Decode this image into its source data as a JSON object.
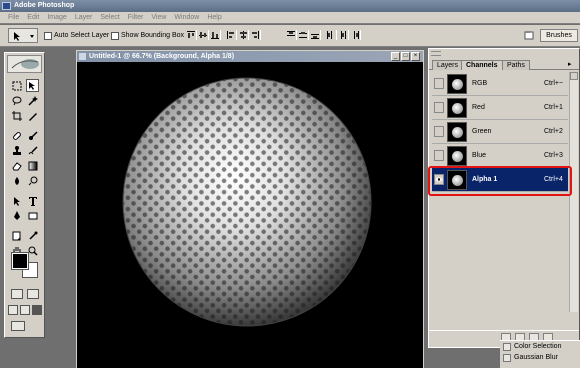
{
  "app": {
    "title": "Adobe Photoshop"
  },
  "menu": [
    "File",
    "Edit",
    "Image",
    "Layer",
    "Select",
    "Filter",
    "View",
    "Window",
    "Help"
  ],
  "options": {
    "auto_select_layer": "Auto Select Layer",
    "show_bounding_box": "Show Bounding Box",
    "brushes_tab": "Brushes"
  },
  "document": {
    "title": "Untitled-1 @ 66.7% (Background, Alpha 1/8)"
  },
  "palette": {
    "tabs": [
      "Layers",
      "Channels",
      "Paths"
    ],
    "active_tab": "Channels",
    "channels": [
      {
        "name": "RGB",
        "shortcut": "Ctrl+~",
        "visible": false,
        "selected": false
      },
      {
        "name": "Red",
        "shortcut": "Ctrl+1",
        "visible": false,
        "selected": false
      },
      {
        "name": "Green",
        "shortcut": "Ctrl+2",
        "visible": false,
        "selected": false
      },
      {
        "name": "Blue",
        "shortcut": "Ctrl+3",
        "visible": false,
        "selected": false
      },
      {
        "name": "Alpha 1",
        "shortcut": "Ctrl+4",
        "visible": true,
        "selected": true
      }
    ]
  },
  "history": {
    "items": [
      "Color Selection",
      "Gaussian Blur"
    ]
  },
  "colors": {
    "selection": "#0a246a",
    "highlight": "#e41414",
    "chrome": "#d4d0c8"
  }
}
